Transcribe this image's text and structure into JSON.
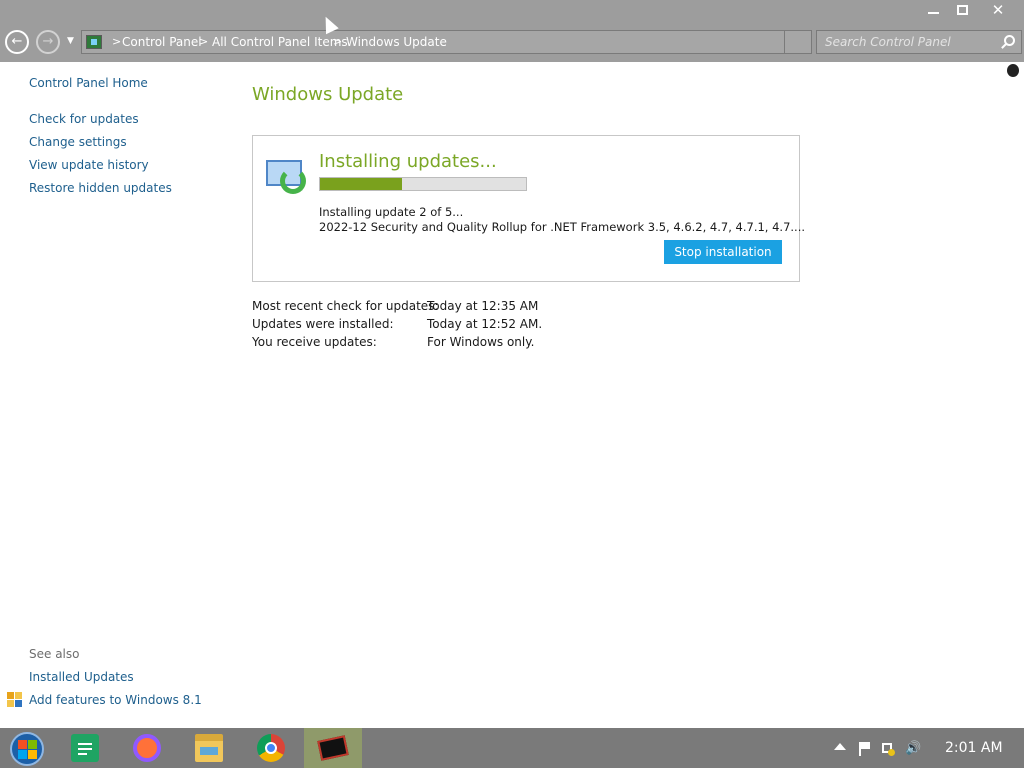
{
  "window": {
    "minimize_icon": "minimize-icon",
    "maximize_icon": "restore-icon",
    "close_icon": "close-icon",
    "close_glyph": "✕"
  },
  "address_bar": {
    "back_glyph": "←",
    "forward_glyph": "→",
    "crumbs": [
      "Control Panel",
      "All Control Panel Items",
      "Windows Update"
    ],
    "separator": ">"
  },
  "search": {
    "placeholder": "Search Control Panel"
  },
  "sidebar": {
    "home": "Control Panel Home",
    "items": [
      {
        "label": "Check for updates"
      },
      {
        "label": "Change settings"
      },
      {
        "label": "View update history"
      },
      {
        "label": "Restore hidden updates"
      }
    ],
    "see_also_label": "See also",
    "see_also": [
      {
        "label": "Installed Updates"
      },
      {
        "label": "Add features to Windows 8.1"
      }
    ]
  },
  "main": {
    "title": "Windows Update",
    "status_title": "Installing updates...",
    "progress": 0.4,
    "progress_color": "#7aa11d",
    "detail_line1": "Installing update 2 of 5...",
    "detail_line2": "2022-12 Security and Quality Rollup for .NET Framework 3.5, 4.6.2, 4.7, 4.7.1, 4.7....",
    "stop_button": "Stop installation",
    "info": [
      {
        "label": "Most recent check for updates:",
        "value": "Today at 12:35 AM"
      },
      {
        "label": "Updates were installed:",
        "value": "Today at 12:52 AM."
      },
      {
        "label": "You receive updates:",
        "value": "For Windows only."
      }
    ]
  },
  "colors": {
    "accent_green": "#7ba726",
    "link_blue": "#1e5f8d",
    "button_blue": "#1ba1e2"
  },
  "taskbar": {
    "apps": [
      "start-orb-icon",
      "sheets-icon",
      "firefox-icon",
      "file-explorer-icon",
      "chrome-icon",
      "video-app-icon"
    ],
    "tray": [
      "show-hidden-icons",
      "flag-icon",
      "network-icon",
      "volume-icon"
    ],
    "volume_glyph": "🔊",
    "clock": "2:01 AM"
  }
}
